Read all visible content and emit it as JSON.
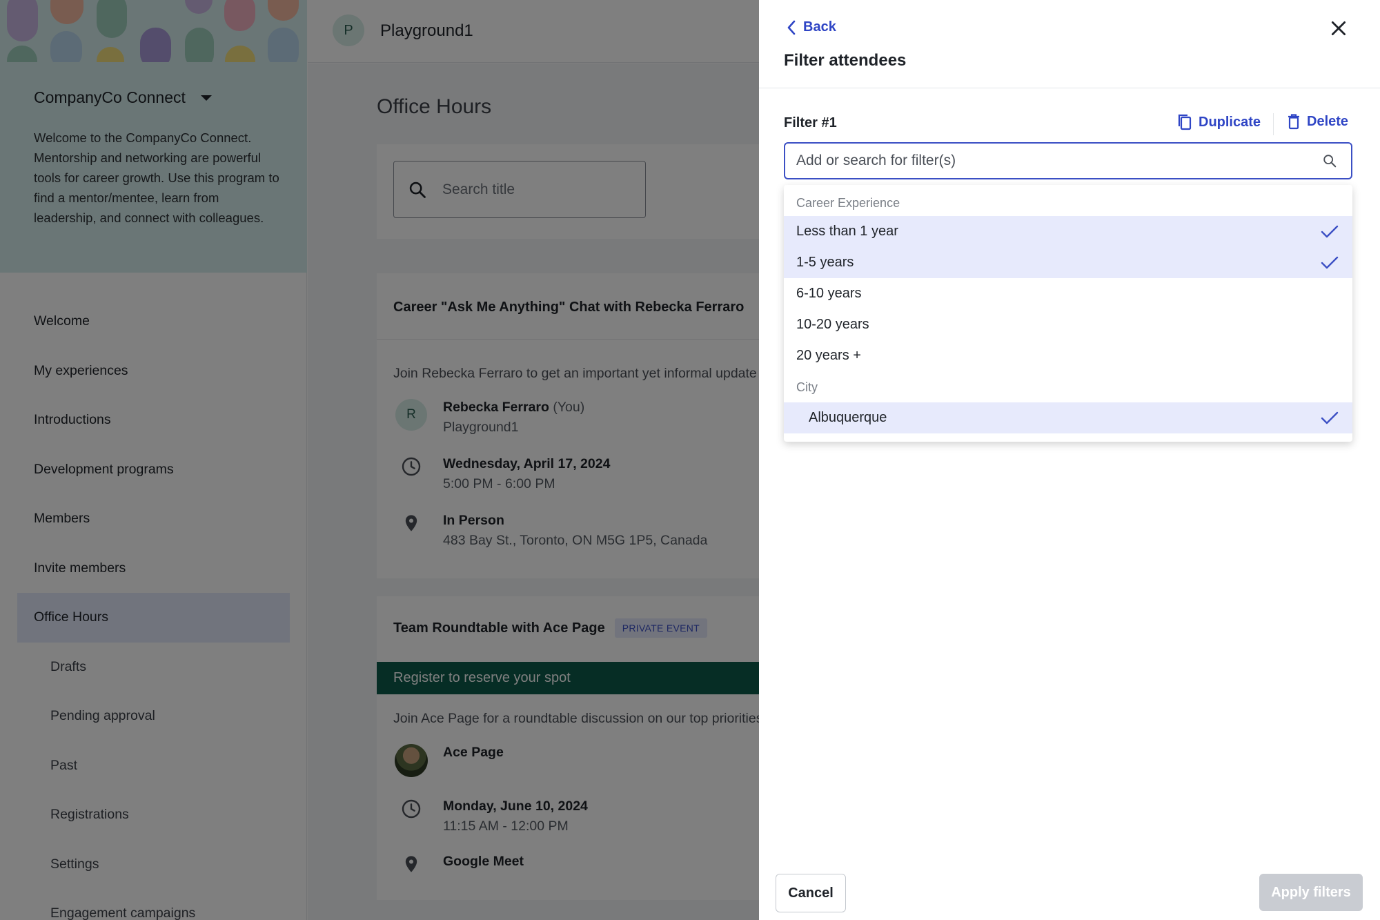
{
  "sidebar": {
    "program_name": "CompanyCo Connect",
    "program_description": "Welcome to the CompanyCo Connect. Mentorship and networking are powerful tools for career growth. Use this program to find a mentor/mentee, learn from leadership, and connect with colleagues.",
    "nav": [
      {
        "label": "Welcome"
      },
      {
        "label": "My experiences"
      },
      {
        "label": "Introductions"
      },
      {
        "label": "Development programs"
      },
      {
        "label": "Members"
      },
      {
        "label": "Invite members"
      },
      {
        "label": "Office Hours",
        "active": true
      },
      {
        "label": "Drafts"
      },
      {
        "label": "Pending approval"
      },
      {
        "label": "Past"
      },
      {
        "label": "Registrations"
      },
      {
        "label": "Settings"
      },
      {
        "label": "Engagement campaigns"
      }
    ]
  },
  "topbar": {
    "avatar_initial": "P",
    "workspace_name": "Playground1"
  },
  "main": {
    "page_title": "Office Hours",
    "search_placeholder": "Search title",
    "events": [
      {
        "title": "Career \"Ask Me Anything\" Chat with Rebecka Ferraro",
        "description": "Join Rebecka Ferraro to get an important yet informal update",
        "host_initial": "R",
        "host_name": "Rebecka Ferraro",
        "host_you": "(You)",
        "host_org": "Playground1",
        "date": "Wednesday, April 17, 2024",
        "time": "5:00 PM - 6:00 PM",
        "location_type": "In Person",
        "address": "483 Bay St., Toronto, ON M5G 1P5, Canada"
      },
      {
        "title": "Team Roundtable with Ace Page",
        "badge": "PRIVATE EVENT",
        "register_text": "Register to reserve your spot",
        "description": "Join Ace Page for a roundtable discussion on our top priorities",
        "host_name": "Ace Page",
        "date": "Monday, June 10, 2024",
        "time": "11:15 AM - 12:00 PM",
        "location_type": "Google Meet"
      }
    ]
  },
  "panel": {
    "back_label": "Back",
    "title": "Filter attendees",
    "filter_label": "Filter #1",
    "duplicate_label": "Duplicate",
    "delete_label": "Delete",
    "filter_placeholder": "Add or search for filter(s)",
    "groups": {
      "career": {
        "heading": "Career Experience",
        "options": [
          {
            "label": "Less than 1 year",
            "selected": true
          },
          {
            "label": "1-5 years",
            "selected": true
          },
          {
            "label": "6-10 years",
            "selected": false
          },
          {
            "label": "10-20 years",
            "selected": false
          },
          {
            "label": "20 years +",
            "selected": false
          }
        ]
      },
      "city": {
        "heading": "City",
        "options": [
          {
            "label": "Albuquerque",
            "selected": true
          }
        ]
      }
    },
    "cancel_label": "Cancel",
    "apply_label": "Apply filters"
  },
  "colors": {
    "accent": "#2f45c5",
    "selected_row": "#e7eafc",
    "register_bar": "#0d5a4a",
    "banner": "#d4ecec",
    "nav_active": "#e3e8fb"
  }
}
